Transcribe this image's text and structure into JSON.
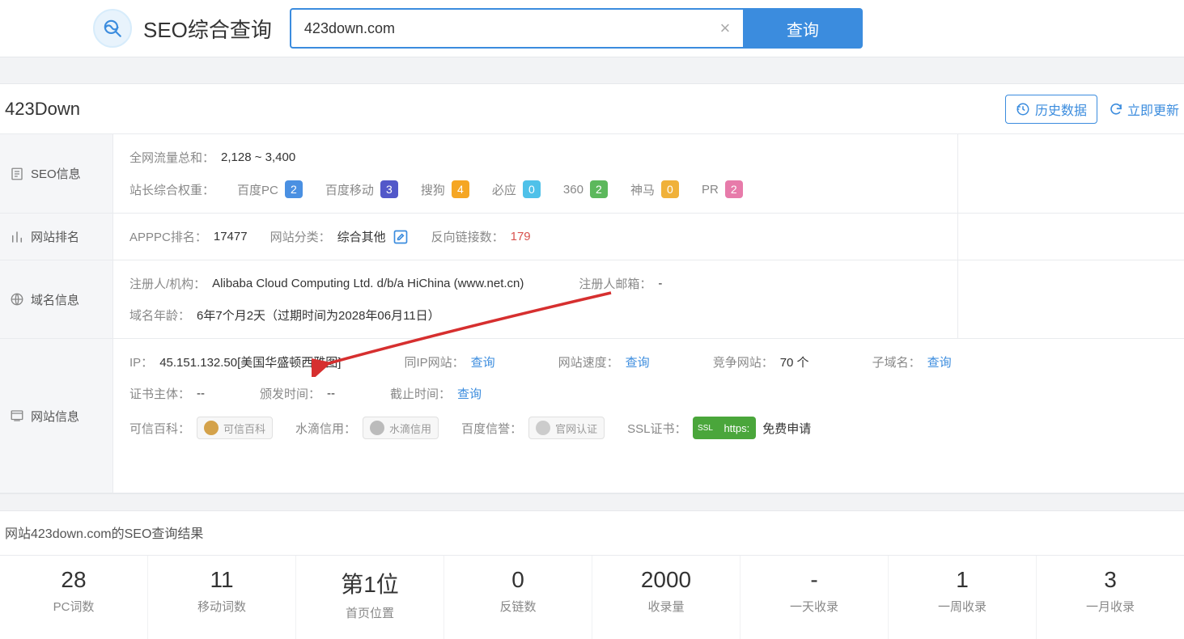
{
  "header": {
    "brand": "SEO综合查询",
    "search_value": "423down.com",
    "search_placeholder": "",
    "search_btn": "查询"
  },
  "title": {
    "site_name": "423Down",
    "history_btn": "历史数据",
    "refresh_link": "立即更新"
  },
  "seo": {
    "section_label": "SEO信息",
    "traffic_label": "全网流量总和：",
    "traffic_value": "2,128 ~ 3,400",
    "weight_label": "站长综合权重：",
    "items": [
      {
        "name": "百度PC",
        "val": "2",
        "cls": "b-blue"
      },
      {
        "name": "百度移动",
        "val": "3",
        "cls": "b-indigo"
      },
      {
        "name": "搜狗",
        "val": "4",
        "cls": "b-orange"
      },
      {
        "name": "必应",
        "val": "0",
        "cls": "b-cyan"
      },
      {
        "name": "360",
        "val": "2",
        "cls": "b-green"
      },
      {
        "name": "神马",
        "val": "0",
        "cls": "b-amber"
      },
      {
        "name": "PR",
        "val": "2",
        "cls": "b-pink"
      }
    ]
  },
  "rank": {
    "section_label": "网站排名",
    "apppc_label": "APPPC排名：",
    "apppc_value": "17477",
    "cat_label": "网站分类：",
    "cat_value": "综合其他",
    "backlink_label": "反向链接数：",
    "backlink_value": "179"
  },
  "domain": {
    "section_label": "域名信息",
    "registrant_label": "注册人/机构：",
    "registrant_value": "Alibaba Cloud Computing Ltd. d/b/a HiChina (www.net.cn)",
    "email_label": "注册人邮箱：",
    "email_value": "-",
    "age_label": "域名年龄：",
    "age_value": "6年7个月2天（过期时间为2028年06月11日）"
  },
  "site": {
    "section_label": "网站信息",
    "ip_label": "IP：",
    "ip_value": "45.151.132.50[美国华盛顿西雅图]",
    "sameip_label": "同IP网站：",
    "speed_label": "网站速度：",
    "compete_label": "竞争网站：",
    "compete_value": "70 个",
    "subdomain_label": "子域名：",
    "query_link": "查询",
    "cert_subj_label": "证书主体：",
    "cert_subj_value": "--",
    "issue_label": "颁发时间：",
    "issue_value": "--",
    "end_label": "截止时间：",
    "trust_label": "可信百科：",
    "trust_tag": "可信百科",
    "shuidi_label": "水滴信用：",
    "shuidi_tag": "水滴信用",
    "baidu_label": "百度信誉：",
    "baidu_tag": "官网认证",
    "ssl_label": "SSL证书：",
    "ssl_badge_txt": "https:",
    "ssl_badge_ico": "SSL",
    "ssl_apply": "免费申请"
  },
  "results": {
    "heading": "网站423down.com的SEO查询结果",
    "stats": [
      {
        "num": "28",
        "cap": "PC词数"
      },
      {
        "num": "11",
        "cap": "移动词数"
      },
      {
        "num": "第1位",
        "cap": "首页位置"
      },
      {
        "num": "0",
        "cap": "反链数"
      },
      {
        "num": "2000",
        "cap": "收录量"
      },
      {
        "num": "-",
        "cap": "一天收录"
      },
      {
        "num": "1",
        "cap": "一周收录"
      },
      {
        "num": "3",
        "cap": "一月收录"
      }
    ]
  }
}
